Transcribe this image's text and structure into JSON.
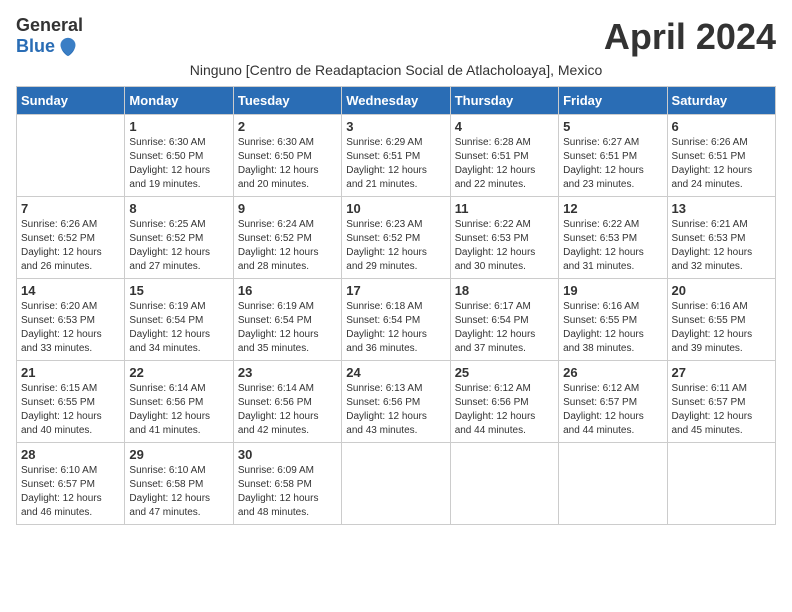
{
  "logo": {
    "general": "General",
    "blue": "Blue"
  },
  "title": "April 2024",
  "subtitle": "Ninguno [Centro de Readaptacion Social de Atlacholoaya], Mexico",
  "days_of_week": [
    "Sunday",
    "Monday",
    "Tuesday",
    "Wednesday",
    "Thursday",
    "Friday",
    "Saturday"
  ],
  "weeks": [
    [
      {
        "day": "",
        "sunrise": "",
        "sunset": "",
        "daylight": ""
      },
      {
        "day": "1",
        "sunrise": "Sunrise: 6:30 AM",
        "sunset": "Sunset: 6:50 PM",
        "daylight": "Daylight: 12 hours and 19 minutes."
      },
      {
        "day": "2",
        "sunrise": "Sunrise: 6:30 AM",
        "sunset": "Sunset: 6:50 PM",
        "daylight": "Daylight: 12 hours and 20 minutes."
      },
      {
        "day": "3",
        "sunrise": "Sunrise: 6:29 AM",
        "sunset": "Sunset: 6:51 PM",
        "daylight": "Daylight: 12 hours and 21 minutes."
      },
      {
        "day": "4",
        "sunrise": "Sunrise: 6:28 AM",
        "sunset": "Sunset: 6:51 PM",
        "daylight": "Daylight: 12 hours and 22 minutes."
      },
      {
        "day": "5",
        "sunrise": "Sunrise: 6:27 AM",
        "sunset": "Sunset: 6:51 PM",
        "daylight": "Daylight: 12 hours and 23 minutes."
      },
      {
        "day": "6",
        "sunrise": "Sunrise: 6:26 AM",
        "sunset": "Sunset: 6:51 PM",
        "daylight": "Daylight: 12 hours and 24 minutes."
      }
    ],
    [
      {
        "day": "7",
        "sunrise": "Sunrise: 6:26 AM",
        "sunset": "Sunset: 6:52 PM",
        "daylight": "Daylight: 12 hours and 26 minutes."
      },
      {
        "day": "8",
        "sunrise": "Sunrise: 6:25 AM",
        "sunset": "Sunset: 6:52 PM",
        "daylight": "Daylight: 12 hours and 27 minutes."
      },
      {
        "day": "9",
        "sunrise": "Sunrise: 6:24 AM",
        "sunset": "Sunset: 6:52 PM",
        "daylight": "Daylight: 12 hours and 28 minutes."
      },
      {
        "day": "10",
        "sunrise": "Sunrise: 6:23 AM",
        "sunset": "Sunset: 6:52 PM",
        "daylight": "Daylight: 12 hours and 29 minutes."
      },
      {
        "day": "11",
        "sunrise": "Sunrise: 6:22 AM",
        "sunset": "Sunset: 6:53 PM",
        "daylight": "Daylight: 12 hours and 30 minutes."
      },
      {
        "day": "12",
        "sunrise": "Sunrise: 6:22 AM",
        "sunset": "Sunset: 6:53 PM",
        "daylight": "Daylight: 12 hours and 31 minutes."
      },
      {
        "day": "13",
        "sunrise": "Sunrise: 6:21 AM",
        "sunset": "Sunset: 6:53 PM",
        "daylight": "Daylight: 12 hours and 32 minutes."
      }
    ],
    [
      {
        "day": "14",
        "sunrise": "Sunrise: 6:20 AM",
        "sunset": "Sunset: 6:53 PM",
        "daylight": "Daylight: 12 hours and 33 minutes."
      },
      {
        "day": "15",
        "sunrise": "Sunrise: 6:19 AM",
        "sunset": "Sunset: 6:54 PM",
        "daylight": "Daylight: 12 hours and 34 minutes."
      },
      {
        "day": "16",
        "sunrise": "Sunrise: 6:19 AM",
        "sunset": "Sunset: 6:54 PM",
        "daylight": "Daylight: 12 hours and 35 minutes."
      },
      {
        "day": "17",
        "sunrise": "Sunrise: 6:18 AM",
        "sunset": "Sunset: 6:54 PM",
        "daylight": "Daylight: 12 hours and 36 minutes."
      },
      {
        "day": "18",
        "sunrise": "Sunrise: 6:17 AM",
        "sunset": "Sunset: 6:54 PM",
        "daylight": "Daylight: 12 hours and 37 minutes."
      },
      {
        "day": "19",
        "sunrise": "Sunrise: 6:16 AM",
        "sunset": "Sunset: 6:55 PM",
        "daylight": "Daylight: 12 hours and 38 minutes."
      },
      {
        "day": "20",
        "sunrise": "Sunrise: 6:16 AM",
        "sunset": "Sunset: 6:55 PM",
        "daylight": "Daylight: 12 hours and 39 minutes."
      }
    ],
    [
      {
        "day": "21",
        "sunrise": "Sunrise: 6:15 AM",
        "sunset": "Sunset: 6:55 PM",
        "daylight": "Daylight: 12 hours and 40 minutes."
      },
      {
        "day": "22",
        "sunrise": "Sunrise: 6:14 AM",
        "sunset": "Sunset: 6:56 PM",
        "daylight": "Daylight: 12 hours and 41 minutes."
      },
      {
        "day": "23",
        "sunrise": "Sunrise: 6:14 AM",
        "sunset": "Sunset: 6:56 PM",
        "daylight": "Daylight: 12 hours and 42 minutes."
      },
      {
        "day": "24",
        "sunrise": "Sunrise: 6:13 AM",
        "sunset": "Sunset: 6:56 PM",
        "daylight": "Daylight: 12 hours and 43 minutes."
      },
      {
        "day": "25",
        "sunrise": "Sunrise: 6:12 AM",
        "sunset": "Sunset: 6:56 PM",
        "daylight": "Daylight: 12 hours and 44 minutes."
      },
      {
        "day": "26",
        "sunrise": "Sunrise: 6:12 AM",
        "sunset": "Sunset: 6:57 PM",
        "daylight": "Daylight: 12 hours and 44 minutes."
      },
      {
        "day": "27",
        "sunrise": "Sunrise: 6:11 AM",
        "sunset": "Sunset: 6:57 PM",
        "daylight": "Daylight: 12 hours and 45 minutes."
      }
    ],
    [
      {
        "day": "28",
        "sunrise": "Sunrise: 6:10 AM",
        "sunset": "Sunset: 6:57 PM",
        "daylight": "Daylight: 12 hours and 46 minutes."
      },
      {
        "day": "29",
        "sunrise": "Sunrise: 6:10 AM",
        "sunset": "Sunset: 6:58 PM",
        "daylight": "Daylight: 12 hours and 47 minutes."
      },
      {
        "day": "30",
        "sunrise": "Sunrise: 6:09 AM",
        "sunset": "Sunset: 6:58 PM",
        "daylight": "Daylight: 12 hours and 48 minutes."
      },
      {
        "day": "",
        "sunrise": "",
        "sunset": "",
        "daylight": ""
      },
      {
        "day": "",
        "sunrise": "",
        "sunset": "",
        "daylight": ""
      },
      {
        "day": "",
        "sunrise": "",
        "sunset": "",
        "daylight": ""
      },
      {
        "day": "",
        "sunrise": "",
        "sunset": "",
        "daylight": ""
      }
    ]
  ]
}
